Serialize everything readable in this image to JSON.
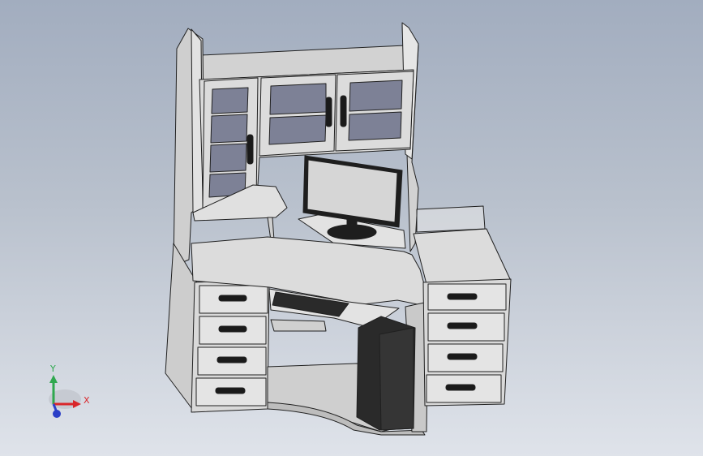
{
  "viewport": {
    "background_top": "#a2adbf",
    "background_bottom": "#dfe3ea"
  },
  "model": {
    "body_color": "#d6d6d6",
    "edge_color": "#202020",
    "glass_color": "#7d8196",
    "handle_color": "#1a1a1a",
    "pc_color": "#2a2a2a"
  },
  "triad": {
    "x_label": "X",
    "y_label": "Y",
    "x_color": "#d9262b",
    "y_color": "#2fa84f",
    "z_color": "#2b3fc7"
  }
}
